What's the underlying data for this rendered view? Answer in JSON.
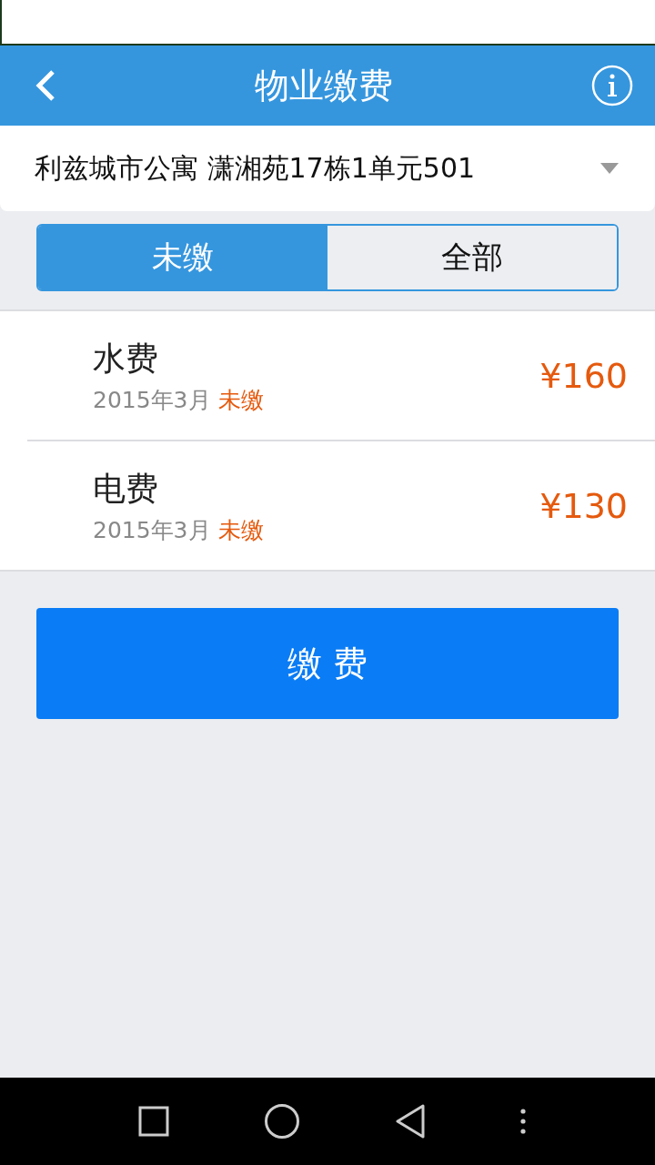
{
  "header": {
    "title": "物业缴费"
  },
  "address": {
    "value": "利兹城市公寓 潇湘苑17栋1单元501"
  },
  "tabs": [
    {
      "label": "未缴",
      "selected": true
    },
    {
      "label": "全部",
      "selected": false
    }
  ],
  "bills": [
    {
      "name": "水费",
      "period": "2015年3月",
      "status": "未缴",
      "amount": "¥160"
    },
    {
      "name": "电费",
      "period": "2015年3月",
      "status": "未缴",
      "amount": "¥130"
    }
  ],
  "pay_button": {
    "label": "缴 费"
  }
}
